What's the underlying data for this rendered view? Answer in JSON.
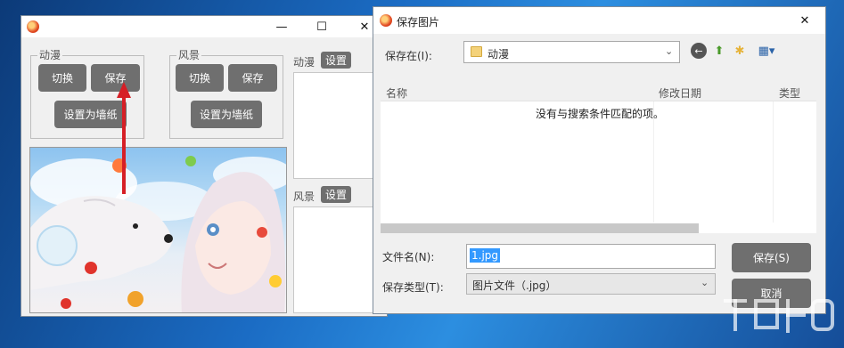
{
  "main_window": {
    "minimize_glyph": "—",
    "maximize_glyph": "☐",
    "close_glyph": "✕",
    "anime_group": {
      "title": "动漫",
      "switch_label": "切换",
      "save_label": "保存",
      "set_wallpaper_label": "设置为墙纸"
    },
    "scenery_group": {
      "title": "风景",
      "switch_label": "切换",
      "save_label": "保存",
      "set_wallpaper_label": "设置为墙纸"
    },
    "anime_side": {
      "label": "动漫",
      "button": "设置"
    },
    "scenery_side": {
      "label": "风景",
      "button": "设置"
    }
  },
  "save_dialog": {
    "title": "保存图片",
    "close_glyph": "✕",
    "save_in_label": "保存在(I):",
    "save_in_value": "动漫",
    "columns": [
      "名称",
      "修改日期",
      "类型"
    ],
    "empty_message": "没有与搜索条件匹配的项。",
    "filename_label": "文件名(N):",
    "filename_value": "1.jpg",
    "filetype_label": "保存类型(T):",
    "filetype_value": "图片文件（.jpg）",
    "save_button": "保存(S)",
    "cancel_button": "取消"
  },
  "colors": {
    "button_gray": "#6f6f6f",
    "arrow_red": "#d61f26",
    "selection_blue": "#3399ff"
  }
}
